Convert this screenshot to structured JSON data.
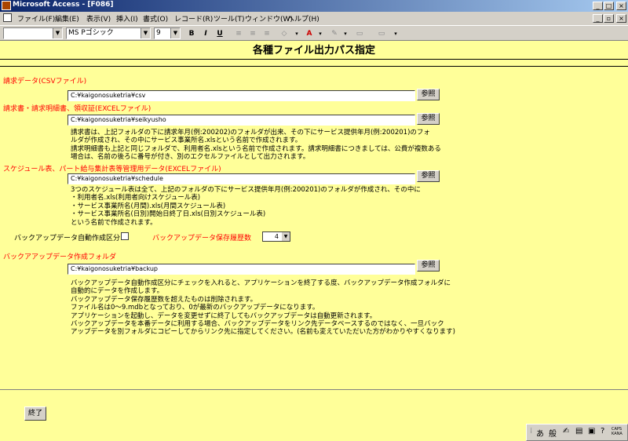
{
  "window": {
    "title": "Microsoft Access - [F086]"
  },
  "menu": [
    "ファイル(F)",
    "編集(E)",
    "表示(V)",
    "挿入(I)",
    "書式(O)",
    "レコード(R)",
    "ツール(T)",
    "ウィンドウ(W)",
    "ヘルプ(H)"
  ],
  "toolbar": {
    "font_name": "MS Pゴシック",
    "font_size": "9",
    "bold": "B",
    "italic": "I",
    "underline": "U"
  },
  "form": {
    "title": "各種ファイル出力パス指定",
    "browse_label": "参照",
    "section1": {
      "label": "請求データ(CSVファイル)",
      "path": "C:¥kaigonosuketria¥csv"
    },
    "section2": {
      "label": "請求書・請求明細書、領収証(EXCELファイル)",
      "path": "C:¥kaigonosuketria¥seikyusho",
      "note": "請求書は、上記フォルダの下に請求年月(例:200202)のフォルダが出来、その下にサービス提供年月(例:200201)のフォ\nルダが作成され、その中にサービス事業所名.xlsという名前で作成されます。\n請求明細書も上記と同じフォルダで、利用者名.xlsという名前で作成されます。請求明細書につきましては、公費が複数ある\n場合は、名前の後ろに番号が付き、別のエクセルファイルとして出力されます。"
    },
    "section3": {
      "label": "スケジュール表、パート給与集計表等管理用データ(EXCELファイル)",
      "path": "C:¥kaigonosuketria¥schedule",
      "note": "3つのスケジュール表は全て、上記のフォルダの下にサービス提供年月(例:200201)のフォルダが作成され、その中に\n・利用者名.xls(利用者向けスケジュール表)\n・サービス事業所名(月間).xls(月間スケジュール表)\n・サービス事業所名(日別)開始日終了日.xls(日別スケジュール表)\nという名前で作成されます。"
    },
    "backup_auto_label": "バックアップデータ自動作成区分",
    "backup_count_label": "バックアップデータ保存履歴数",
    "backup_count_value": "4",
    "section4": {
      "label": "バックアアップデータ作成フォルダ",
      "path": "C:¥kaigonosuketria¥backup",
      "note": "バックアップデータ自動作成区分にチェックを入れると、アプリケーションを終了する度、バックアップデータ作成フォルダに\n自動的にデータを作成します。\nバックアップデータ保存履歴数を超えたものは削除されます。\nファイル名は0〜9.mdbとなっており、0が最新のバックアップデータになります。\nアプリケーションを起動し、データを変更せずに終了してもバックアップデータは自動更新されます。\nバックアップデータを本番データに利用する場合、バックアップデータをリンク先データベースするのではなく、一旦バック\nアップデータを別フォルダにコピーしてからリンク先に指定してください。(名前も変えていただいた方がわかりやすくなります)"
    },
    "exit_label": "終了"
  },
  "ime": {
    "mode1": "あ",
    "mode2": "般",
    "caps": "CAPS",
    "kana": "KANA"
  }
}
